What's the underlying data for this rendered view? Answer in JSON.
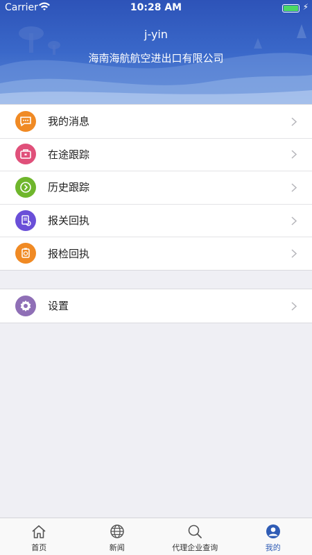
{
  "status_bar": {
    "carrier": "Carrier",
    "time": "10:28 AM"
  },
  "profile": {
    "username": "j-yin",
    "company": "海南海航航空进出口有限公司"
  },
  "menu": [
    {
      "label": "我的消息",
      "icon": "message-icon",
      "color": "#f08a24"
    },
    {
      "label": "在途跟踪",
      "icon": "briefcase-icon",
      "color": "#e0507a"
    },
    {
      "label": "历史跟踪",
      "icon": "history-arrow-icon",
      "color": "#6fb62c"
    },
    {
      "label": "报关回执",
      "icon": "document-receipt-icon",
      "color": "#6a4fd8"
    },
    {
      "label": "报检回执",
      "icon": "inspection-stamp-icon",
      "color": "#f08a24"
    }
  ],
  "settings": {
    "label": "设置",
    "icon": "gear-icon",
    "color": "#8f6fb6"
  },
  "tabs": [
    {
      "label": "首页",
      "icon": "home-icon",
      "active": false
    },
    {
      "label": "新闻",
      "icon": "globe-icon",
      "active": false
    },
    {
      "label": "代理企业查询",
      "icon": "search-icon",
      "active": false
    },
    {
      "label": "我的",
      "icon": "user-icon",
      "active": true
    }
  ],
  "colors": {
    "accent": "#2f5cb5",
    "header": "#2d53b8"
  }
}
